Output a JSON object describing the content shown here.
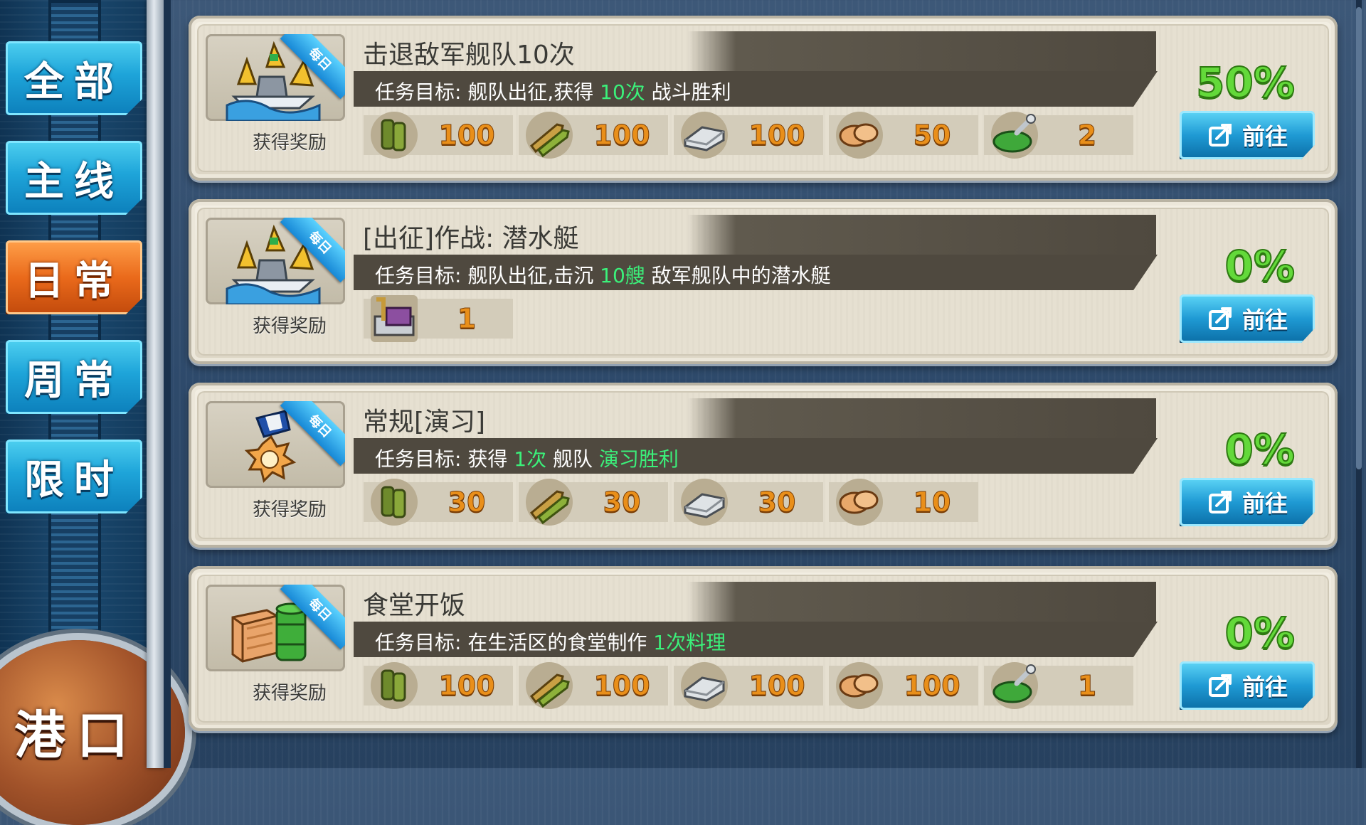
{
  "sidebar": {
    "tabs": [
      {
        "label": "全部",
        "active": false
      },
      {
        "label": "主线",
        "active": false
      },
      {
        "label": "日常",
        "active": true
      },
      {
        "label": "周常",
        "active": false
      },
      {
        "label": "限时",
        "active": false
      }
    ],
    "harbor_button": "港口"
  },
  "colors": {
    "accent": "#1ea4d9",
    "active_tab": "#ea6a1b",
    "progress": "#63d93a",
    "highlight": "#3bf07a",
    "reward_number": "#e98f1a"
  },
  "quests": [
    {
      "icon": "fleet-attack-icon",
      "badge": "每日",
      "title": "击退敌军舰队10次",
      "goal_prefix": "任务目标: 舰队出征,获得 ",
      "goal_highlight": "10次",
      "goal_suffix": " 战斗胜利",
      "reward_label": "获得奖励",
      "rewards": [
        {
          "icon": "fuel-icon",
          "amount": "100"
        },
        {
          "icon": "ammo-icon",
          "amount": "100"
        },
        {
          "icon": "steel-icon",
          "amount": "100"
        },
        {
          "icon": "bauxite-icon",
          "amount": "50"
        },
        {
          "icon": "repair-kit-icon",
          "amount": "2"
        }
      ],
      "progress": "50%",
      "go_label": "前往"
    },
    {
      "icon": "fleet-attack-icon",
      "badge": "每日",
      "title": "[出征]作战: 潜水艇",
      "goal_prefix": "任务目标: 舰队出征,击沉 ",
      "goal_highlight": "10艘",
      "goal_suffix": " 敌军舰队中的潜水艇",
      "reward_label": "获得奖励",
      "rewards": [
        {
          "icon": "construction-material-icon",
          "amount": "1"
        }
      ],
      "progress": "0%",
      "go_label": "前往"
    },
    {
      "icon": "exercise-medal-icon",
      "badge": "每日",
      "title": "常规[演习]",
      "goal_prefix": "任务目标: 获得 ",
      "goal_highlight": "1次",
      "goal_mid": " 舰队 ",
      "goal_highlight2": "演习胜利",
      "goal_suffix": "",
      "reward_label": "获得奖励",
      "rewards": [
        {
          "icon": "fuel-icon",
          "amount": "30"
        },
        {
          "icon": "ammo-icon",
          "amount": "30"
        },
        {
          "icon": "steel-icon",
          "amount": "30"
        },
        {
          "icon": "bauxite-icon",
          "amount": "10"
        }
      ],
      "progress": "0%",
      "go_label": "前往"
    },
    {
      "icon": "supplies-crate-icon",
      "badge": "每日",
      "title": "食堂开饭",
      "goal_prefix": "任务目标: 在生活区的食堂制作 ",
      "goal_highlight": "1次料理",
      "goal_suffix": "",
      "reward_label": "获得奖励",
      "rewards": [
        {
          "icon": "fuel-icon",
          "amount": "100"
        },
        {
          "icon": "ammo-icon",
          "amount": "100"
        },
        {
          "icon": "steel-icon",
          "amount": "100"
        },
        {
          "icon": "bauxite-icon",
          "amount": "100"
        },
        {
          "icon": "repair-kit-icon",
          "amount": "1"
        }
      ],
      "progress": "0%",
      "go_label": "前往"
    }
  ]
}
